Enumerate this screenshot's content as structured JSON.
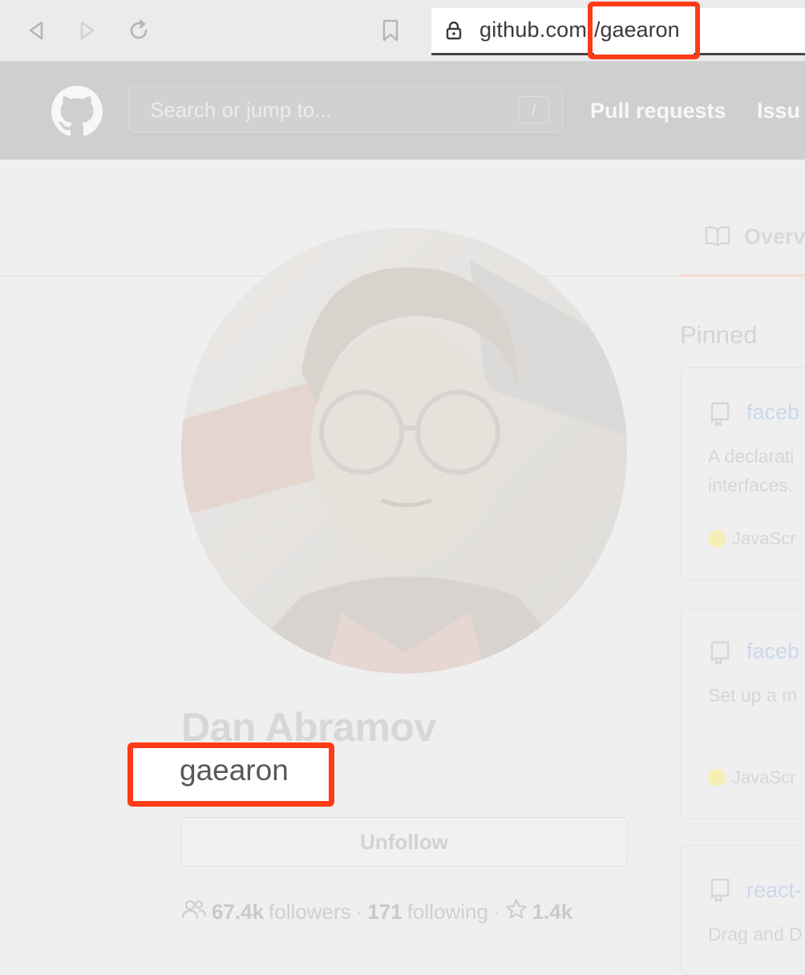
{
  "browser": {
    "url_host": "github.com",
    "url_path": "/gaearon"
  },
  "header": {
    "search_placeholder": "Search or jump to...",
    "search_shortcut": "/",
    "nav": [
      "Pull requests",
      "Issu"
    ]
  },
  "profile": {
    "full_name": "Dan Abramov",
    "username": "gaearon",
    "unfollow_label": "Unfollow",
    "followers_count": "67.4k",
    "followers_label": "followers",
    "following_count": "171",
    "following_label": "following",
    "separator": "·",
    "stars_count": "1.4k"
  },
  "tabs": {
    "overview": "Overv"
  },
  "pinned": {
    "title": "Pinned",
    "cards": [
      {
        "repo": "faceb",
        "desc": [
          "A declarati",
          "interfaces."
        ],
        "lang": "JavaScr"
      },
      {
        "repo": "faceb",
        "desc": [
          "Set up a m"
        ],
        "lang": "JavaScr"
      },
      {
        "repo": "react-",
        "desc": [
          "Drag and D"
        ],
        "lang": ""
      }
    ]
  },
  "colors": {
    "highlight": "#ff3b17",
    "lang_javascript": "#f6eeb7"
  }
}
